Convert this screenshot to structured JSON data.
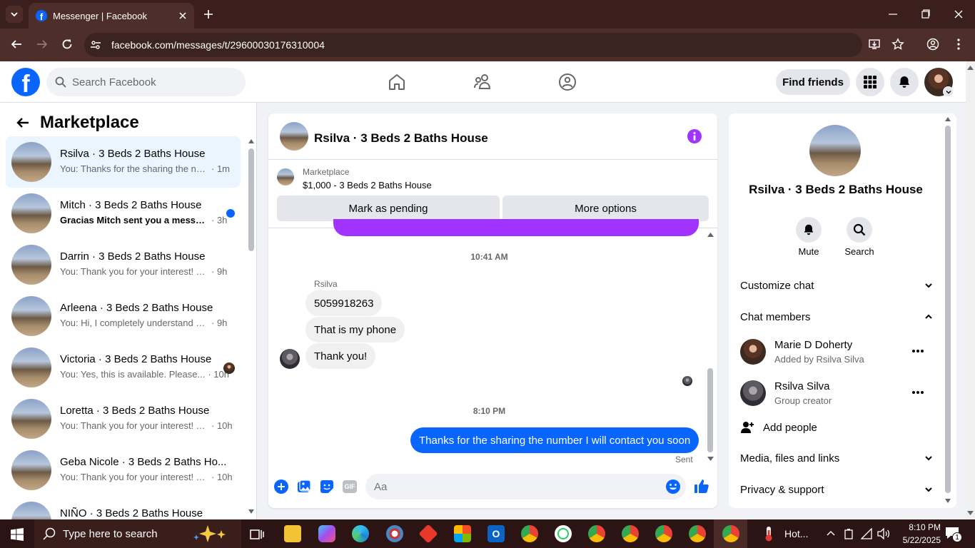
{
  "browser": {
    "tab_title": "Messenger | Facebook",
    "url": "facebook.com/messages/t/29600030176310004"
  },
  "header": {
    "search_placeholder": "Search Facebook",
    "find_friends": "Find friends"
  },
  "left": {
    "title": "Marketplace",
    "conversations": [
      {
        "name": "Rsilva · 3 Beds 2 Baths House",
        "preview": "You: Thanks for the sharing the nu...",
        "time": "· 1m",
        "active": true
      },
      {
        "name": "Mitch · 3 Beds 2 Baths House",
        "preview": "Gracias Mitch sent you a messa...",
        "time": "· 3h",
        "unread": true
      },
      {
        "name": "Darrin · 3 Beds 2 Baths House",
        "preview": "You: Thank you for your interest! Ye...",
        "time": "· 9h"
      },
      {
        "name": "Arleena · 3 Beds 2 Baths House",
        "preview": "You: Hi, I completely understand yo...",
        "time": "· 9h"
      },
      {
        "name": "Victoria · 3 Beds 2 Baths House",
        "preview": "You: Yes, this is available. Please...",
        "time": "· 10h"
      },
      {
        "name": "Loretta · 3 Beds 2 Baths House",
        "preview": "You: Thank you for your interest! Y...",
        "time": "· 10h"
      },
      {
        "name": "Geba Nicole · 3 Beds 2 Baths Ho...",
        "preview": "You: Thank you for your interest! Y...",
        "time": "· 10h"
      },
      {
        "name": "NIÑO · 3 Beds 2 Baths House",
        "preview": "",
        "time": ""
      }
    ]
  },
  "chat": {
    "title": "Rsilva · 3 Beds 2 Baths House",
    "marketplace_label": "Marketplace",
    "listing": "$1,000 - 3 Beds 2 Baths House",
    "mark_pending": "Mark as pending",
    "more_options": "More options",
    "time1": "10:41 AM",
    "sender": "Rsilva",
    "msg1": "5059918263",
    "msg2": "That is my phone",
    "msg3": "Thank you!",
    "time2": "8:10 PM",
    "msg_out": "Thanks for the sharing the number I will contact you soon",
    "sent": "Sent",
    "composer_placeholder": "Aa"
  },
  "right": {
    "name": "Rsilva · 3 Beds 2 Baths House",
    "mute": "Mute",
    "search": "Search",
    "customize": "Customize chat",
    "members": "Chat members",
    "member1_name": "Marie D Doherty",
    "member1_sub": "Added by Rsilva Silva",
    "member2_name": "Rsilva Silva",
    "member2_sub": "Group creator",
    "add_people": "Add people",
    "media": "Media, files and links",
    "privacy": "Privacy & support"
  },
  "taskbar": {
    "search": "Type here to search",
    "weather": "Hot...",
    "time": "8:10 PM",
    "date": "5/22/2025",
    "notif_count": "1"
  },
  "colors": {
    "fb_blue": "#0866ff",
    "purple": "#a033ff",
    "chrome_frame": "#3b1f1c"
  }
}
